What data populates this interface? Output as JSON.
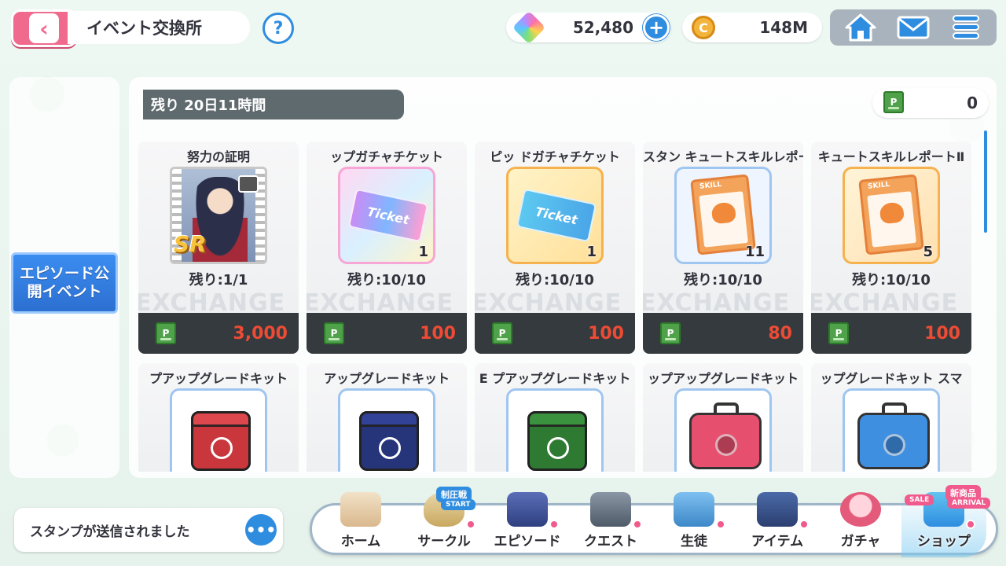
{
  "header": {
    "title": "イベント交換所",
    "help_label": "?",
    "gems": "52,480",
    "coins": "148M",
    "plus_label": "+"
  },
  "sidebar": {
    "episode_button": "エピソード公開イベント",
    "episode_line1": "エピソード公",
    "episode_line2": "開イベント"
  },
  "shop": {
    "time_left": "残り 20日11時間",
    "points": "0",
    "watermark": "EXCHANGE",
    "currency_icon": "P",
    "items": [
      {
        "name": "努力の証明",
        "remain": "残り:1/1",
        "cost": "3,000",
        "qty": "",
        "art": "sr-card"
      },
      {
        "name": "ップガチャチケット",
        "remain": "残り:10/10",
        "cost": "100",
        "qty": "1",
        "art": "ticket-pink"
      },
      {
        "name": "ピッ   ドガチャチケット",
        "remain": "残り:10/10",
        "cost": "100",
        "qty": "1",
        "art": "ticket-blue"
      },
      {
        "name": "スタン  キュートスキルレポートⅠ",
        "remain": "残り:10/10",
        "cost": "80",
        "qty": "11",
        "art": "skill-1"
      },
      {
        "name": "キュートスキルレポートⅡ",
        "remain": "残り:10/10",
        "cost": "100",
        "qty": "5",
        "art": "skill-2"
      }
    ],
    "items_row2": [
      {
        "name": "プアップグレードキット",
        "art": "box-red"
      },
      {
        "name": "アップグレードキット",
        "art": "box-navy"
      },
      {
        "name": "E  プアップグレードキット",
        "art": "box-green"
      },
      {
        "name": "ップアップグレードキット",
        "art": "case-pink"
      },
      {
        "name": "ップグレードキット    スマ",
        "art": "case-blue"
      }
    ],
    "sr_label": "SR",
    "ticket_text": "Ticket",
    "skill_text": "SKILL"
  },
  "chat": {
    "message": "スタンプが送信されました"
  },
  "footer": {
    "items": [
      {
        "label": "ホーム"
      },
      {
        "label": "サークル",
        "tag": "制圧戦",
        "tag2": "START"
      },
      {
        "label": "エピソード"
      },
      {
        "label": "クエスト"
      },
      {
        "label": "生徒"
      },
      {
        "label": "アイテム"
      },
      {
        "label": "ガチャ"
      },
      {
        "label": "ショップ",
        "tag": "新商品",
        "tag2": "ARRIVAL",
        "sale": "SALE"
      }
    ]
  },
  "colors": {
    "accent_pink": "#f06a8d",
    "accent_blue": "#2f8de0",
    "cost_red": "#ee4b35",
    "panel_dark": "#343a3d"
  }
}
